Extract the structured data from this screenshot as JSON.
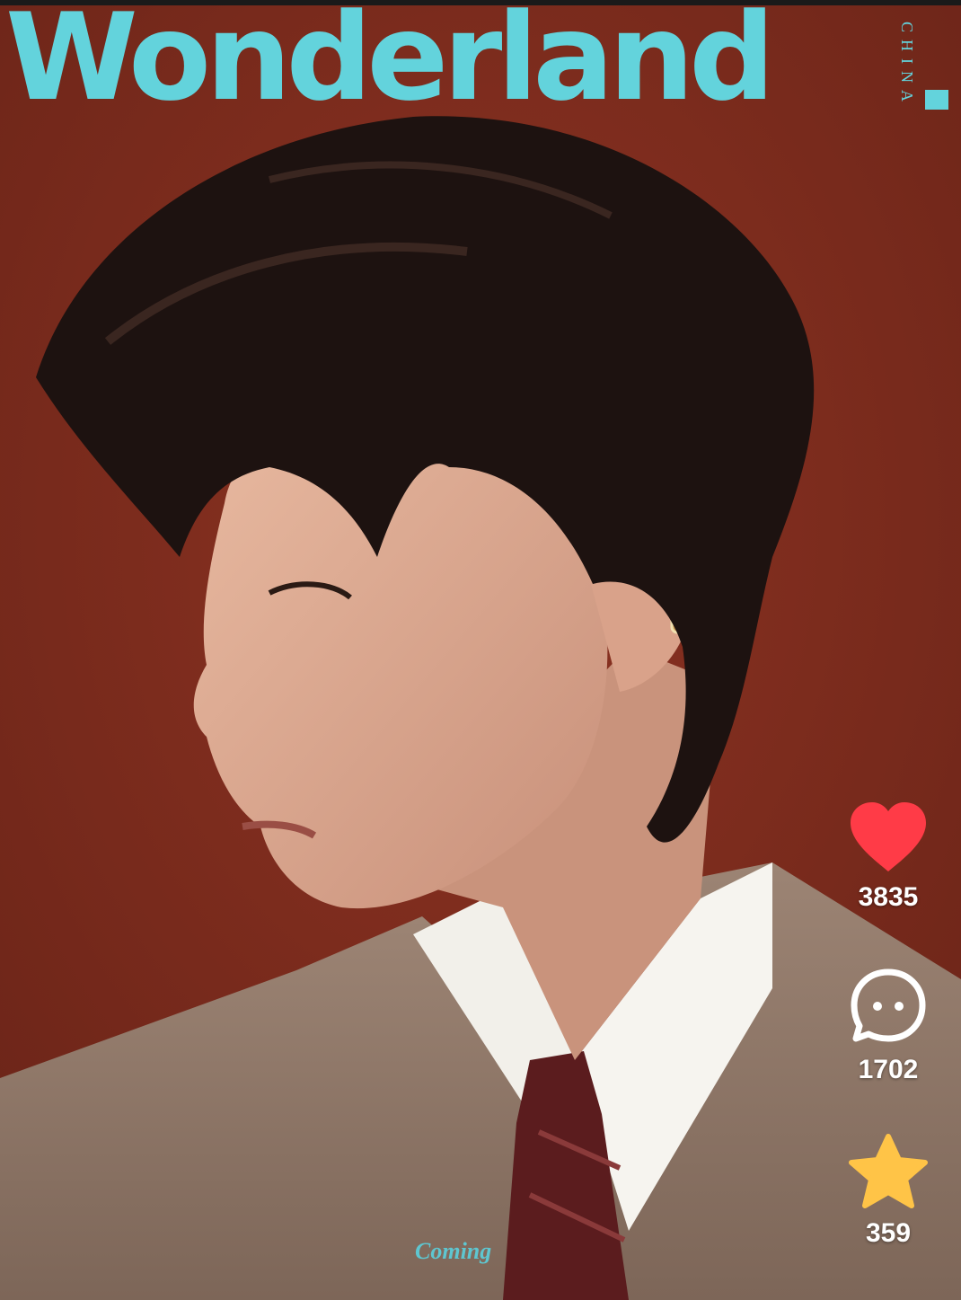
{
  "cover": {
    "masthead": "Wonderland",
    "edition": "CHINA",
    "footer_text": "Coming"
  },
  "actions": {
    "like": {
      "count": "3835",
      "icon": "heart-icon"
    },
    "comment": {
      "count": "1702",
      "icon": "comment-bubble-icon"
    },
    "favorite": {
      "count": "359",
      "icon": "star-icon"
    }
  },
  "colors": {
    "background": "#7a2a1c",
    "masthead": "#63d3dc",
    "like": "#ff3b47",
    "favorite": "#ffc447",
    "counts": "#ffffff"
  }
}
